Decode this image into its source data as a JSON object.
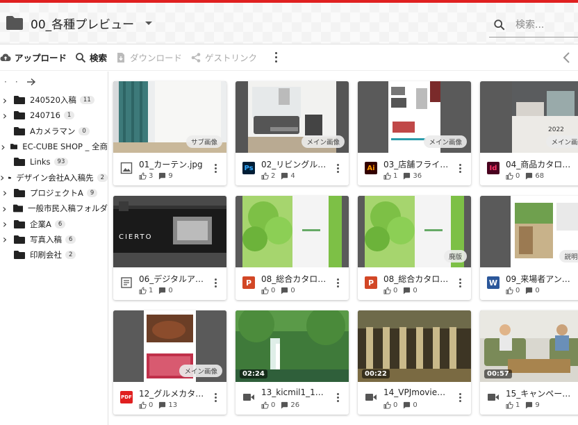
{
  "header": {
    "folder_title": "00_各種プレビュー",
    "search_placeholder": "検索..."
  },
  "toolbar": {
    "upload": "アップロード",
    "search": "検索",
    "download": "ダウンロード",
    "guest_link": "ゲストリンク"
  },
  "sidebar": {
    "items": [
      {
        "label": "240520入稿",
        "count": "11",
        "expandable": true
      },
      {
        "label": "240716",
        "count": "1",
        "expandable": true
      },
      {
        "label": "Aカメラマン",
        "count": "0",
        "expandable": false
      },
      {
        "label": "EC-CUBE SHOP _ 全商",
        "count": "",
        "expandable": true
      },
      {
        "label": "Links",
        "count": "93",
        "expandable": false
      },
      {
        "label": "デザイン会社A入稿先",
        "count": "2",
        "expandable": true
      },
      {
        "label": "プロジェクトA",
        "count": "9",
        "expandable": true
      },
      {
        "label": "一般市民入稿フォルダ",
        "count": "",
        "expandable": true
      },
      {
        "label": "企業A",
        "count": "6",
        "expandable": true
      },
      {
        "label": "写真入稿",
        "count": "6",
        "expandable": true
      },
      {
        "label": "印刷会社",
        "count": "2",
        "expandable": false
      }
    ]
  },
  "files": [
    {
      "name": "01_カーテン.jpg",
      "likes": "3",
      "comments": "9",
      "chip": "サブ画像",
      "duration": "",
      "type": "image",
      "thumb": "curtain"
    },
    {
      "name": "02_リビングル…",
      "likes": "2",
      "comments": "4",
      "chip": "メイン画像",
      "duration": "",
      "type": "ps",
      "thumb": "living"
    },
    {
      "name": "03_店舗フライ…",
      "likes": "1",
      "comments": "36",
      "chip": "メイン画像",
      "duration": "",
      "type": "ai",
      "thumb": "flyer"
    },
    {
      "name": "04_商品カタロ…",
      "likes": "0",
      "comments": "68",
      "chip": "メイン画像",
      "duration": "",
      "type": "id",
      "thumb": "catalog"
    },
    {
      "name": "06_デジタルア…",
      "likes": "1",
      "comments": "0",
      "chip": "",
      "duration": "",
      "type": "doc",
      "thumb": "digital"
    },
    {
      "name": "08_総合カタロ…",
      "likes": "0",
      "comments": "0",
      "chip": "",
      "duration": "",
      "type": "ppt",
      "thumb": "green"
    },
    {
      "name": "08_総合カタロ…",
      "likes": "0",
      "comments": "0",
      "chip": "廃版",
      "duration": "",
      "type": "ppt",
      "thumb": "green"
    },
    {
      "name": "09_来場者アン…",
      "likes": "0",
      "comments": "0",
      "chip": "説明資",
      "duration": "",
      "type": "word",
      "thumb": "survey"
    },
    {
      "name": "12_グルメカタ…",
      "likes": "0",
      "comments": "13",
      "chip": "メイン画像",
      "duration": "",
      "type": "pdf",
      "thumb": "gourmet"
    },
    {
      "name": "13_kicmil1_1…",
      "likes": "0",
      "comments": "26",
      "chip": "",
      "duration": "02:24",
      "type": "video",
      "thumb": "waterfall"
    },
    {
      "name": "14_VPJmovie…",
      "likes": "0",
      "comments": "0",
      "chip": "",
      "duration": "00:22",
      "type": "video",
      "thumb": "ruins"
    },
    {
      "name": "15_キャンペー…",
      "likes": "1",
      "comments": "9",
      "chip": "",
      "duration": "00:57",
      "type": "video",
      "thumb": "sofa"
    }
  ],
  "thumb_text": {
    "digital_title": "CIERTO",
    "catalog_year": "2022"
  }
}
